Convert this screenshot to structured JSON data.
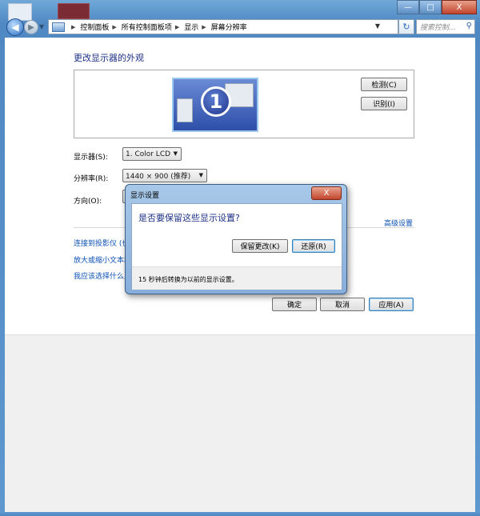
{
  "window": {
    "minimize": "—",
    "maximize": "□",
    "close": "X"
  },
  "nav": {
    "back_icon": "◀",
    "forward_icon": "▶",
    "history_icon": "▼",
    "breadcrumbs": [
      "控制面板",
      "所有控制面板项",
      "显示",
      "屏幕分辨率"
    ],
    "breadcrumb_sep": "▶",
    "address_dropdown": "▼",
    "refresh_icon": "↻",
    "search_placeholder": "搜索控制...",
    "search_icon": "⚲"
  },
  "main": {
    "title": "更改显示器的外观",
    "monitor_number": "1",
    "detect_button": "检测(C)",
    "identify_button": "识别(I)",
    "display_label": "显示器(S):",
    "display_value": "1. Color LCD",
    "resolution_label": "分辨率(R):",
    "resolution_value": "1440 × 900 (推荐)",
    "orientation_label": "方向(O):",
    "advanced_link": "高级设置",
    "links": [
      "连接到投影仪 (也",
      "放大或缩小文本和",
      "我应该选择什么显"
    ],
    "ok_button": "确定",
    "cancel_button": "取消",
    "apply_button": "应用(A)"
  },
  "dialog": {
    "title": "显示设置",
    "close": "X",
    "question": "是否要保留这些显示设置?",
    "keep_button": "保留更改(K)",
    "revert_button": "还原(R)",
    "countdown_note": "15 秒钟后转换为以前的显示设置。"
  },
  "colors": {
    "accent": "#1e3287",
    "link": "#0a4fb3",
    "frame": "#5f97cf"
  }
}
